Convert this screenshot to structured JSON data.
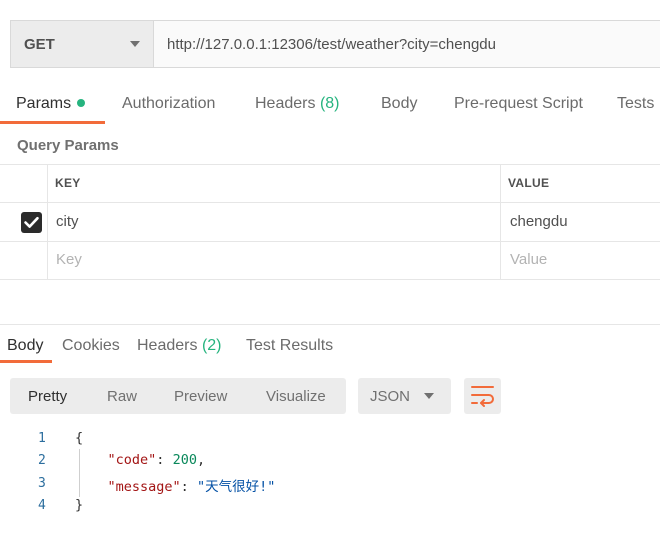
{
  "request": {
    "method": "GET",
    "url": "http://127.0.0.1:12306/test/weather?city=chengdu"
  },
  "tabs": [
    {
      "label": "Params",
      "active": true
    },
    {
      "label": "Authorization"
    },
    {
      "label": "Headers",
      "count": "(8)"
    },
    {
      "label": "Body"
    },
    {
      "label": "Pre-request Script"
    },
    {
      "label": "Tests"
    }
  ],
  "query_params": {
    "title": "Query Params",
    "columns": {
      "key": "KEY",
      "value": "VALUE"
    },
    "rows": [
      {
        "checked": true,
        "key": "city",
        "value": "chengdu"
      }
    ],
    "placeholder": {
      "key": "Key",
      "value": "Value"
    }
  },
  "response": {
    "tabs": [
      {
        "label": "Body",
        "active": true
      },
      {
        "label": "Cookies"
      },
      {
        "label": "Headers",
        "count": "(2)"
      },
      {
        "label": "Test Results"
      }
    ],
    "view_modes": [
      "Pretty",
      "Raw",
      "Preview",
      "Visualize"
    ],
    "active_view": "Pretty",
    "format": "JSON",
    "wrap_icon": "wrap-lines-icon",
    "code": {
      "line_numbers": [
        "1",
        "2",
        "3",
        "4"
      ],
      "open_brace": "{",
      "close_brace": "}",
      "code_key": "\"code\"",
      "code_value": "200",
      "message_key": "\"message\"",
      "message_value": "\"天气很好!\""
    }
  },
  "colors": {
    "accent": "#f26b3a",
    "active_dot": "#26b47f"
  }
}
